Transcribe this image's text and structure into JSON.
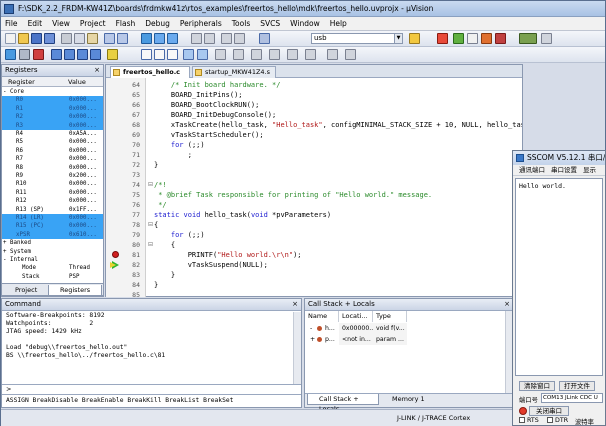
{
  "window": {
    "title": "F:\\SDK_2.2_FRDM-KW41Z\\boards\\frdmkw41z\\rtos_examples\\freertos_hello\\mdk\\freertos_hello.uvprojx - µVision"
  },
  "menu": [
    "File",
    "Edit",
    "View",
    "Project",
    "Flash",
    "Debug",
    "Peripherals",
    "Tools",
    "SVCS",
    "Window",
    "Help"
  ],
  "toolbar": {
    "search_value": "usb"
  },
  "registers": {
    "title": "Registers",
    "headers": {
      "register": "Register",
      "value": "Value"
    },
    "rows": [
      {
        "name": "Core",
        "value": "",
        "indent": 1,
        "expander": "-",
        "selected": false
      },
      {
        "name": "R0",
        "value": "0x000...",
        "indent": 2,
        "selected": true
      },
      {
        "name": "R1",
        "value": "0x000...",
        "indent": 2,
        "selected": true
      },
      {
        "name": "R2",
        "value": "0x000...",
        "indent": 2,
        "selected": true
      },
      {
        "name": "R3",
        "value": "0x000...",
        "indent": 2,
        "selected": true
      },
      {
        "name": "R4",
        "value": "0xA5A...",
        "indent": 2,
        "selected": false
      },
      {
        "name": "R5",
        "value": "0x000...",
        "indent": 2,
        "selected": false
      },
      {
        "name": "R6",
        "value": "0x000...",
        "indent": 2,
        "selected": false
      },
      {
        "name": "R7",
        "value": "0x000...",
        "indent": 2,
        "selected": false
      },
      {
        "name": "R8",
        "value": "0x000...",
        "indent": 2,
        "selected": false
      },
      {
        "name": "R9",
        "value": "0x200...",
        "indent": 2,
        "selected": false
      },
      {
        "name": "R10",
        "value": "0x000...",
        "indent": 2,
        "selected": false
      },
      {
        "name": "R11",
        "value": "0x000...",
        "indent": 2,
        "selected": false
      },
      {
        "name": "R12",
        "value": "0x000...",
        "indent": 2,
        "selected": false
      },
      {
        "name": "R13 (SP)",
        "value": "0x1FF...",
        "indent": 2,
        "selected": false
      },
      {
        "name": "R14 (LR)",
        "value": "0x000...",
        "indent": 2,
        "selected": true
      },
      {
        "name": "R15 (PC)",
        "value": "0x000...",
        "indent": 2,
        "selected": true
      },
      {
        "name": "xPSR",
        "value": "0x610...",
        "indent": 2,
        "selected": true
      },
      {
        "name": "Banked",
        "value": "",
        "indent": 1,
        "expander": "+",
        "selected": false
      },
      {
        "name": "System",
        "value": "",
        "indent": 1,
        "expander": "+",
        "selected": false
      },
      {
        "name": "Internal",
        "value": "",
        "indent": 1,
        "expander": "-",
        "selected": false
      },
      {
        "name": "Mode",
        "value": "Thread",
        "indent": 3,
        "selected": false
      },
      {
        "name": "Stack",
        "value": "PSP",
        "indent": 3,
        "selected": false
      }
    ],
    "tabs": [
      "Project",
      "Registers"
    ]
  },
  "editor": {
    "tabs": [
      "freertos_hello.c",
      "startup_MKW41Z4.s"
    ],
    "lines": [
      {
        "num": "64",
        "segs": [
          {
            "t": "    ",
            "c": ""
          },
          {
            "t": "/* Init board hardware. */",
            "c": "cm"
          }
        ]
      },
      {
        "num": "65",
        "segs": [
          {
            "t": "    BOARD_InitPins();",
            "c": ""
          }
        ]
      },
      {
        "num": "66",
        "segs": [
          {
            "t": "    BOARD_BootClockRUN();",
            "c": ""
          }
        ]
      },
      {
        "num": "67",
        "segs": [
          {
            "t": "    BOARD_InitDebugConsole();",
            "c": ""
          }
        ]
      },
      {
        "num": "68",
        "segs": [
          {
            "t": "    xTaskCreate(hello_task, ",
            "c": ""
          },
          {
            "t": "\"Hello_task\"",
            "c": "str"
          },
          {
            "t": ", configMINIMAL_STACK_SIZE + 10, NULL, hello_task_PRI",
            "c": ""
          }
        ]
      },
      {
        "num": "69",
        "segs": [
          {
            "t": "    vTaskStartScheduler();",
            "c": ""
          }
        ]
      },
      {
        "num": "70",
        "segs": [
          {
            "t": "    ",
            "c": ""
          },
          {
            "t": "for",
            "c": "kw"
          },
          {
            "t": " (;;)",
            "c": ""
          }
        ]
      },
      {
        "num": "71",
        "segs": [
          {
            "t": "        ;",
            "c": ""
          }
        ]
      },
      {
        "num": "72",
        "segs": [
          {
            "t": "}",
            "c": ""
          }
        ]
      },
      {
        "num": "73",
        "segs": [
          {
            "t": "",
            "c": ""
          }
        ]
      },
      {
        "num": "74",
        "segs": [
          {
            "t": "/*!",
            "c": "cm"
          }
        ],
        "fold": "-"
      },
      {
        "num": "75",
        "segs": [
          {
            "t": " * @brief Task responsible for printing of \"Hello world.\" message.",
            "c": "cm"
          }
        ]
      },
      {
        "num": "76",
        "segs": [
          {
            "t": " */",
            "c": "cm"
          }
        ]
      },
      {
        "num": "77",
        "segs": [
          {
            "t": "static",
            "c": "kw"
          },
          {
            "t": " ",
            "c": ""
          },
          {
            "t": "void",
            "c": "kw"
          },
          {
            "t": " hello_task(",
            "c": ""
          },
          {
            "t": "void",
            "c": "kw"
          },
          {
            "t": " *pvParameters)",
            "c": ""
          }
        ]
      },
      {
        "num": "78",
        "segs": [
          {
            "t": "{",
            "c": ""
          }
        ],
        "fold": "-"
      },
      {
        "num": "79",
        "segs": [
          {
            "t": "    ",
            "c": ""
          },
          {
            "t": "for",
            "c": "kw"
          },
          {
            "t": " (;;)",
            "c": ""
          }
        ]
      },
      {
        "num": "80",
        "segs": [
          {
            "t": "    {",
            "c": ""
          }
        ],
        "fold": "-"
      },
      {
        "num": "81",
        "segs": [
          {
            "t": "        PRINTF(",
            "c": ""
          },
          {
            "t": "\"Hello world.\\r\\n\"",
            "c": "str"
          },
          {
            "t": ");",
            "c": ""
          }
        ],
        "breakpoint": true
      },
      {
        "num": "82",
        "segs": [
          {
            "t": "        vTaskSuspend(NULL);",
            "c": ""
          }
        ],
        "current": true
      },
      {
        "num": "83",
        "segs": [
          {
            "t": "    }",
            "c": ""
          }
        ]
      },
      {
        "num": "84",
        "segs": [
          {
            "t": "}",
            "c": ""
          }
        ]
      },
      {
        "num": "85",
        "segs": [
          {
            "t": "",
            "c": ""
          }
        ]
      }
    ]
  },
  "command": {
    "title": "Command",
    "lines": [
      "Software-Breakpoints: 8192",
      "Watchpoints:          2",
      "JTAG speed: 1429 kHz",
      "",
      "Load \"debug\\\\freertos_hello.out\"",
      "BS \\\\freertos_hello\\../freertos_hello.c\\81"
    ],
    "prompt": ">",
    "hint": "ASSIGN BreakDisable BreakEnable BreakKill BreakList BreakSet"
  },
  "callstack": {
    "title": "Call Stack + Locals",
    "headers": [
      "Name",
      "Locati...",
      "Type"
    ],
    "rows": [
      {
        "expander": "-",
        "name": "h...",
        "loc": "0x00000...",
        "type": "void f(v..."
      },
      {
        "expander": "+",
        "name": "p...",
        "loc": "<not in...",
        "type": "param ..."
      }
    ],
    "tabs": [
      "Call Stack + Locals",
      "Memory 1"
    ]
  },
  "status": {
    "debugger": "J-LINK / J-TRACE Cortex"
  },
  "sscom": {
    "title": "SSCOM V5.12.1 串口/",
    "menu": [
      "通讯端口",
      "串口设置",
      "显示"
    ],
    "output": "Hello world.",
    "clear_button": "清除窗口",
    "open_file_button": "打开文件",
    "port_label": "端口号",
    "port_value": "COM13 JLink CDC U",
    "close_port_button": "关闭串口",
    "rts_label": "RTS",
    "dtr_label": "DTR",
    "baud_label": "波特率"
  }
}
